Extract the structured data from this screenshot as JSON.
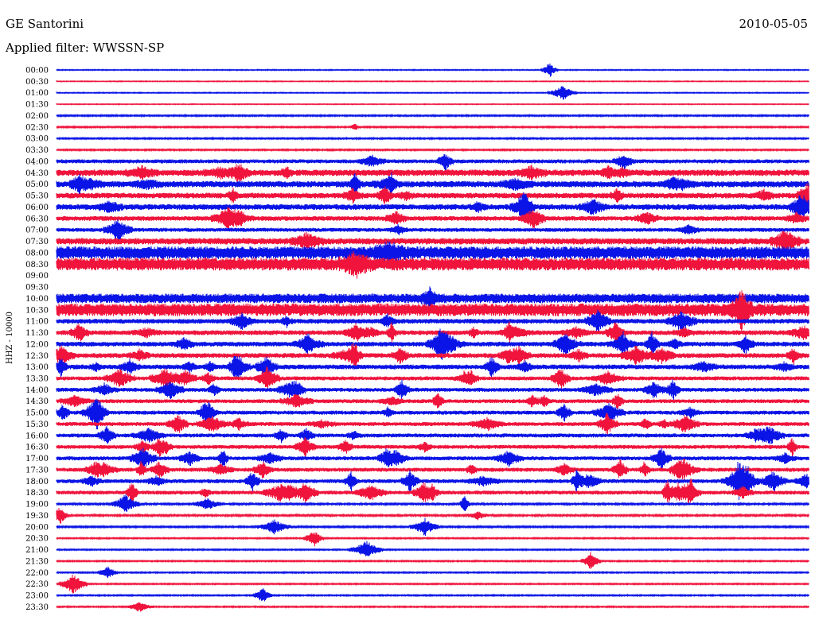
{
  "header": {
    "station": "GE Santorini",
    "date": "2010-05-05",
    "filter": "Applied filter: WWSSN-SP"
  },
  "colors": {
    "blue": "#0a14e6",
    "red": "#f0143c"
  },
  "chart_data": {
    "type": "line",
    "ylabel": "HHZ - 10000",
    "row_labels": [
      "00:00",
      "00:30",
      "01:00",
      "01:30",
      "02:00",
      "02:30",
      "03:00",
      "03:30",
      "04:00",
      "04:30",
      "05:00",
      "05:30",
      "06:00",
      "06:30",
      "07:00",
      "07:30",
      "08:00",
      "08:30",
      "09:00",
      "09:30",
      "10:00",
      "10:30",
      "11:00",
      "11:30",
      "12:00",
      "12:30",
      "13:00",
      "13:30",
      "14:00",
      "14:30",
      "15:00",
      "15:30",
      "16:00",
      "16:30",
      "17:00",
      "17:30",
      "18:00",
      "18:30",
      "19:00",
      "19:30",
      "20:00",
      "20:30",
      "21:00",
      "21:30",
      "22:00",
      "22:30",
      "23:00",
      "23:30"
    ],
    "series_colors": [
      "blue",
      "red"
    ],
    "noise_level": [
      0.6,
      0.5,
      0.6,
      0.5,
      0.9,
      0.9,
      0.9,
      0.9,
      2.5,
      4,
      4,
      3.5,
      3.5,
      3,
      2.5,
      4,
      8,
      8,
      0,
      0,
      6,
      8,
      3,
      3,
      3,
      3,
      3,
      2.5,
      2.5,
      2.5,
      2.5,
      2.5,
      2.5,
      2.5,
      2.5,
      2.5,
      2.5,
      2.5,
      1.2,
      1.2,
      1,
      0.8,
      0.8,
      0.8,
      0.8,
      0.8,
      0.8,
      0.8
    ],
    "event_density": [
      0.01,
      0,
      0.01,
      0,
      0,
      0.01,
      0,
      0,
      0.05,
      0.12,
      0.15,
      0.12,
      0.12,
      0.1,
      0.05,
      0.04,
      0.02,
      0.02,
      0,
      0,
      0.02,
      0.04,
      0.08,
      0.2,
      0.22,
      0.2,
      0.2,
      0.15,
      0.15,
      0.12,
      0.15,
      0.15,
      0.12,
      0.12,
      0.15,
      0.2,
      0.22,
      0.22,
      0.05,
      0.04,
      0.03,
      0.01,
      0.01,
      0.01,
      0.01,
      0.01,
      0.01,
      0.01
    ]
  }
}
